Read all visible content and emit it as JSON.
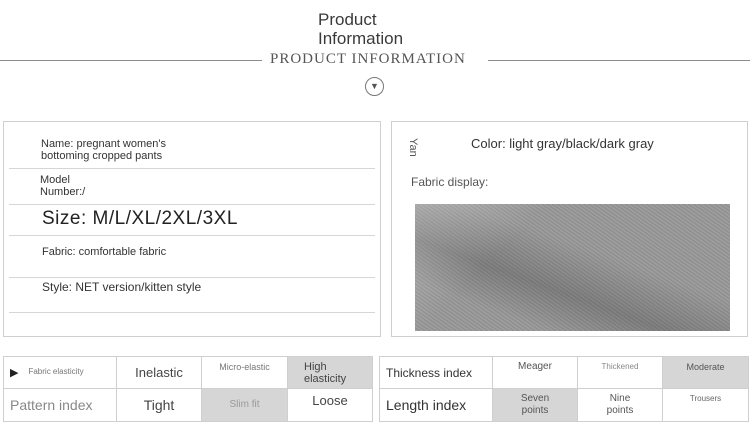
{
  "header": {
    "title_line1": "Product",
    "title_line2": "Information",
    "subtitle": "PRODUCT INFORMATION"
  },
  "icons": {
    "down": "chevron-down-circle-icon",
    "arrow": "triangle-right-icon"
  },
  "product": {
    "name_line1": "Name: pregnant women's",
    "name_line2": "bottoming cropped pants",
    "model_line1": "Model",
    "model_line2": "Number:/",
    "size": "Size: M/L/XL/2XL/3XL",
    "fabric": "Fabric: comfortable fabric",
    "style": "Style: NET version/kitten style"
  },
  "right": {
    "vertical_text": "Yan",
    "color": "Color: light gray/black/dark gray",
    "fabric_display": "Fabric display:"
  },
  "elasticity": {
    "label": "Fabric elasticity",
    "options": [
      "Inelastic",
      "Micro-elastic",
      "High elasticity"
    ],
    "selected": "High elasticity"
  },
  "pattern": {
    "label": "Pattern index",
    "options": [
      "Tight",
      "Slim fit",
      "Loose"
    ],
    "selected": "Slim fit"
  },
  "thickness": {
    "label": "Thickness index",
    "options": [
      "Meager",
      "Thickened",
      "Moderate"
    ],
    "selected": "Moderate"
  },
  "length": {
    "label": "Length index",
    "options": [
      "Seven points",
      "Nine points",
      "Trousers"
    ],
    "selected": "Seven points"
  },
  "colors": {
    "highlight": "#d6d6d6",
    "border": "#cfcfcf"
  }
}
